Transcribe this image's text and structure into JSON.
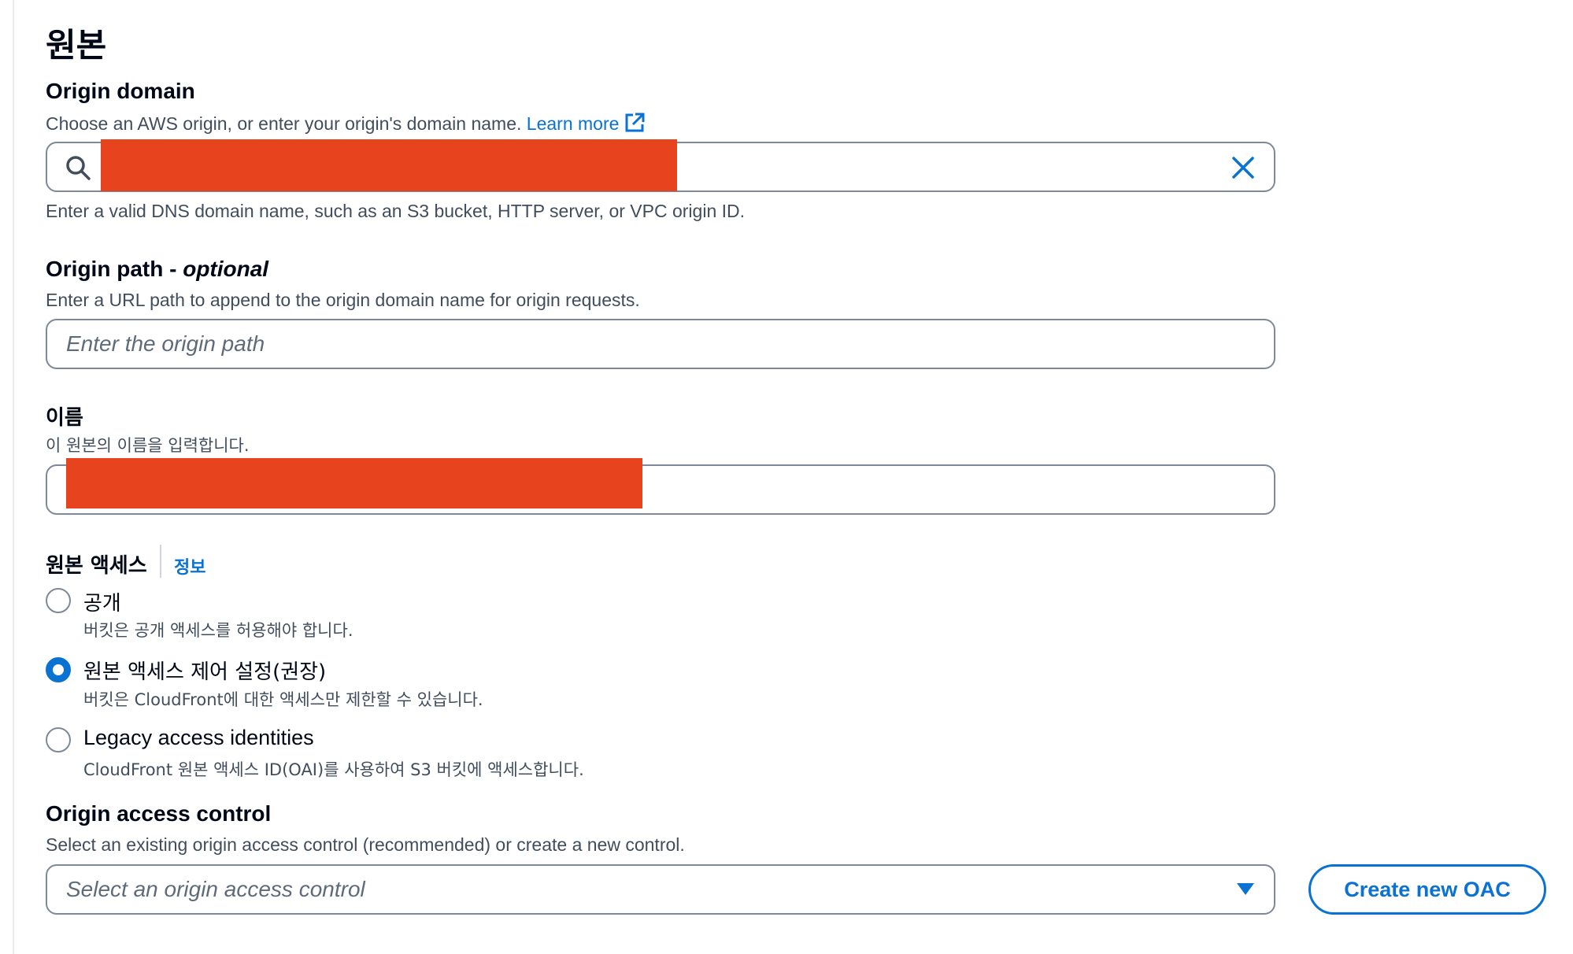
{
  "section": {
    "title": "원본"
  },
  "origin_domain": {
    "label": "Origin domain",
    "description": "Choose an AWS origin, or enter your origin's domain name.",
    "learn_more": "Learn more",
    "help": "Enter a valid DNS domain name, such as an S3 bucket, HTTP server, or VPC origin ID."
  },
  "origin_path": {
    "label": "Origin path - ",
    "label_optional": "optional",
    "description": "Enter a URL path to append to the origin domain name for origin requests.",
    "placeholder": "Enter the origin path"
  },
  "name": {
    "label": "이름",
    "description": "이 원본의 이름을 입력합니다."
  },
  "origin_access": {
    "label": "원본 액세스",
    "info": "정보",
    "options": [
      {
        "label": "공개",
        "description": "버킷은 공개 액세스를 허용해야 합니다.",
        "selected": false
      },
      {
        "label": "원본 액세스 제어 설정(권장)",
        "description": "버킷은 CloudFront에 대한 액세스만 제한할 수 있습니다.",
        "selected": true
      },
      {
        "label": "Legacy access identities",
        "description": "CloudFront 원본 액세스 ID(OAI)를 사용하여 S3 버킷에 액세스합니다.",
        "selected": false
      }
    ]
  },
  "oac": {
    "label": "Origin access control",
    "description": "Select an existing origin access control (recommended) or create a new control.",
    "placeholder": "Select an origin access control",
    "create_button": "Create new OAC"
  },
  "colors": {
    "accent": "#0972d3",
    "redaction": "#e8431f",
    "border": "#7d8998"
  }
}
